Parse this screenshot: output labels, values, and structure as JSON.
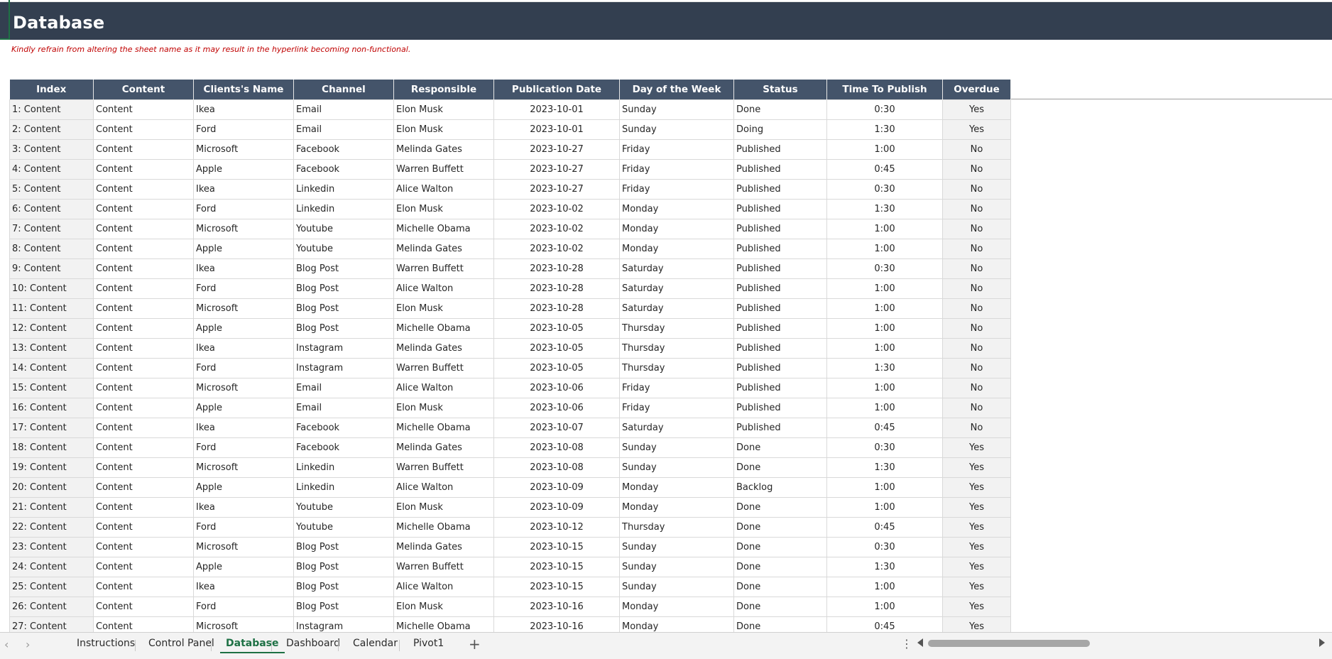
{
  "title": "Database",
  "notice": "Kindly refrain from altering the sheet name as it may result in the hyperlink becoming non-functional.",
  "columns": [
    "Index",
    "Content",
    "Clients's Name",
    "Channel",
    "Responsible",
    "Publication Date",
    "Day of the Week",
    "Status",
    "Time To Publish",
    "Overdue"
  ],
  "rows": [
    [
      "1: Content",
      "Content",
      "Ikea",
      "Email",
      "Elon Musk",
      "2023-10-01",
      "Sunday",
      "Done",
      "0:30",
      "Yes"
    ],
    [
      "2: Content",
      "Content",
      "Ford",
      "Email",
      "Elon Musk",
      "2023-10-01",
      "Sunday",
      "Doing",
      "1:30",
      "Yes"
    ],
    [
      "3: Content",
      "Content",
      "Microsoft",
      "Facebook",
      "Melinda Gates",
      "2023-10-27",
      "Friday",
      "Published",
      "1:00",
      "No"
    ],
    [
      "4: Content",
      "Content",
      "Apple",
      "Facebook",
      "Warren Buffett",
      "2023-10-27",
      "Friday",
      "Published",
      "0:45",
      "No"
    ],
    [
      "5: Content",
      "Content",
      "Ikea",
      "Linkedin",
      "Alice Walton",
      "2023-10-27",
      "Friday",
      "Published",
      "0:30",
      "No"
    ],
    [
      "6: Content",
      "Content",
      "Ford",
      "Linkedin",
      "Elon Musk",
      "2023-10-02",
      "Monday",
      "Published",
      "1:30",
      "No"
    ],
    [
      "7: Content",
      "Content",
      "Microsoft",
      "Youtube",
      "Michelle Obama",
      "2023-10-02",
      "Monday",
      "Published",
      "1:00",
      "No"
    ],
    [
      "8: Content",
      "Content",
      "Apple",
      "Youtube",
      "Melinda Gates",
      "2023-10-02",
      "Monday",
      "Published",
      "1:00",
      "No"
    ],
    [
      "9: Content",
      "Content",
      "Ikea",
      "Blog Post",
      "Warren Buffett",
      "2023-10-28",
      "Saturday",
      "Published",
      "0:30",
      "No"
    ],
    [
      "10: Content",
      "Content",
      "Ford",
      "Blog Post",
      "Alice Walton",
      "2023-10-28",
      "Saturday",
      "Published",
      "1:00",
      "No"
    ],
    [
      "11: Content",
      "Content",
      "Microsoft",
      "Blog Post",
      "Elon Musk",
      "2023-10-28",
      "Saturday",
      "Published",
      "1:00",
      "No"
    ],
    [
      "12: Content",
      "Content",
      "Apple",
      "Blog Post",
      "Michelle Obama",
      "2023-10-05",
      "Thursday",
      "Published",
      "1:00",
      "No"
    ],
    [
      "13: Content",
      "Content",
      "Ikea",
      "Instagram",
      "Melinda Gates",
      "2023-10-05",
      "Thursday",
      "Published",
      "1:00",
      "No"
    ],
    [
      "14: Content",
      "Content",
      "Ford",
      "Instagram",
      "Warren Buffett",
      "2023-10-05",
      "Thursday",
      "Published",
      "1:30",
      "No"
    ],
    [
      "15: Content",
      "Content",
      "Microsoft",
      "Email",
      "Alice Walton",
      "2023-10-06",
      "Friday",
      "Published",
      "1:00",
      "No"
    ],
    [
      "16: Content",
      "Content",
      "Apple",
      "Email",
      "Elon Musk",
      "2023-10-06",
      "Friday",
      "Published",
      "1:00",
      "No"
    ],
    [
      "17: Content",
      "Content",
      "Ikea",
      "Facebook",
      "Michelle Obama",
      "2023-10-07",
      "Saturday",
      "Published",
      "0:45",
      "No"
    ],
    [
      "18: Content",
      "Content",
      "Ford",
      "Facebook",
      "Melinda Gates",
      "2023-10-08",
      "Sunday",
      "Done",
      "0:30",
      "Yes"
    ],
    [
      "19: Content",
      "Content",
      "Microsoft",
      "Linkedin",
      "Warren Buffett",
      "2023-10-08",
      "Sunday",
      "Done",
      "1:30",
      "Yes"
    ],
    [
      "20: Content",
      "Content",
      "Apple",
      "Linkedin",
      "Alice Walton",
      "2023-10-09",
      "Monday",
      "Backlog",
      "1:00",
      "Yes"
    ],
    [
      "21: Content",
      "Content",
      "Ikea",
      "Youtube",
      "Elon Musk",
      "2023-10-09",
      "Monday",
      "Done",
      "1:00",
      "Yes"
    ],
    [
      "22: Content",
      "Content",
      "Ford",
      "Youtube",
      "Michelle Obama",
      "2023-10-12",
      "Thursday",
      "Done",
      "0:45",
      "Yes"
    ],
    [
      "23: Content",
      "Content",
      "Microsoft",
      "Blog Post",
      "Melinda Gates",
      "2023-10-15",
      "Sunday",
      "Done",
      "0:30",
      "Yes"
    ],
    [
      "24: Content",
      "Content",
      "Apple",
      "Blog Post",
      "Warren Buffett",
      "2023-10-15",
      "Sunday",
      "Done",
      "1:30",
      "Yes"
    ],
    [
      "25: Content",
      "Content",
      "Ikea",
      "Blog Post",
      "Alice Walton",
      "2023-10-15",
      "Sunday",
      "Done",
      "1:00",
      "Yes"
    ],
    [
      "26: Content",
      "Content",
      "Ford",
      "Blog Post",
      "Elon Musk",
      "2023-10-16",
      "Monday",
      "Done",
      "1:00",
      "Yes"
    ],
    [
      "27: Content",
      "Content",
      "Microsoft",
      "Instagram",
      "Michelle Obama",
      "2023-10-16",
      "Monday",
      "Done",
      "0:45",
      "Yes"
    ]
  ],
  "tabs": [
    {
      "label": "Instructions",
      "active": false
    },
    {
      "label": "Control Panel",
      "active": false
    },
    {
      "label": "Database",
      "active": true
    },
    {
      "label": "Dashboard",
      "active": false
    },
    {
      "label": "Calendar",
      "active": false
    },
    {
      "label": "Pivot1",
      "active": false
    }
  ],
  "icons": {
    "prev": "‹",
    "next": "›",
    "add": "+",
    "more": "⋮"
  },
  "colors": {
    "title_bar": "#333f50",
    "header": "#44546a",
    "notice": "#c00000",
    "active_tab": "#1e7145"
  }
}
